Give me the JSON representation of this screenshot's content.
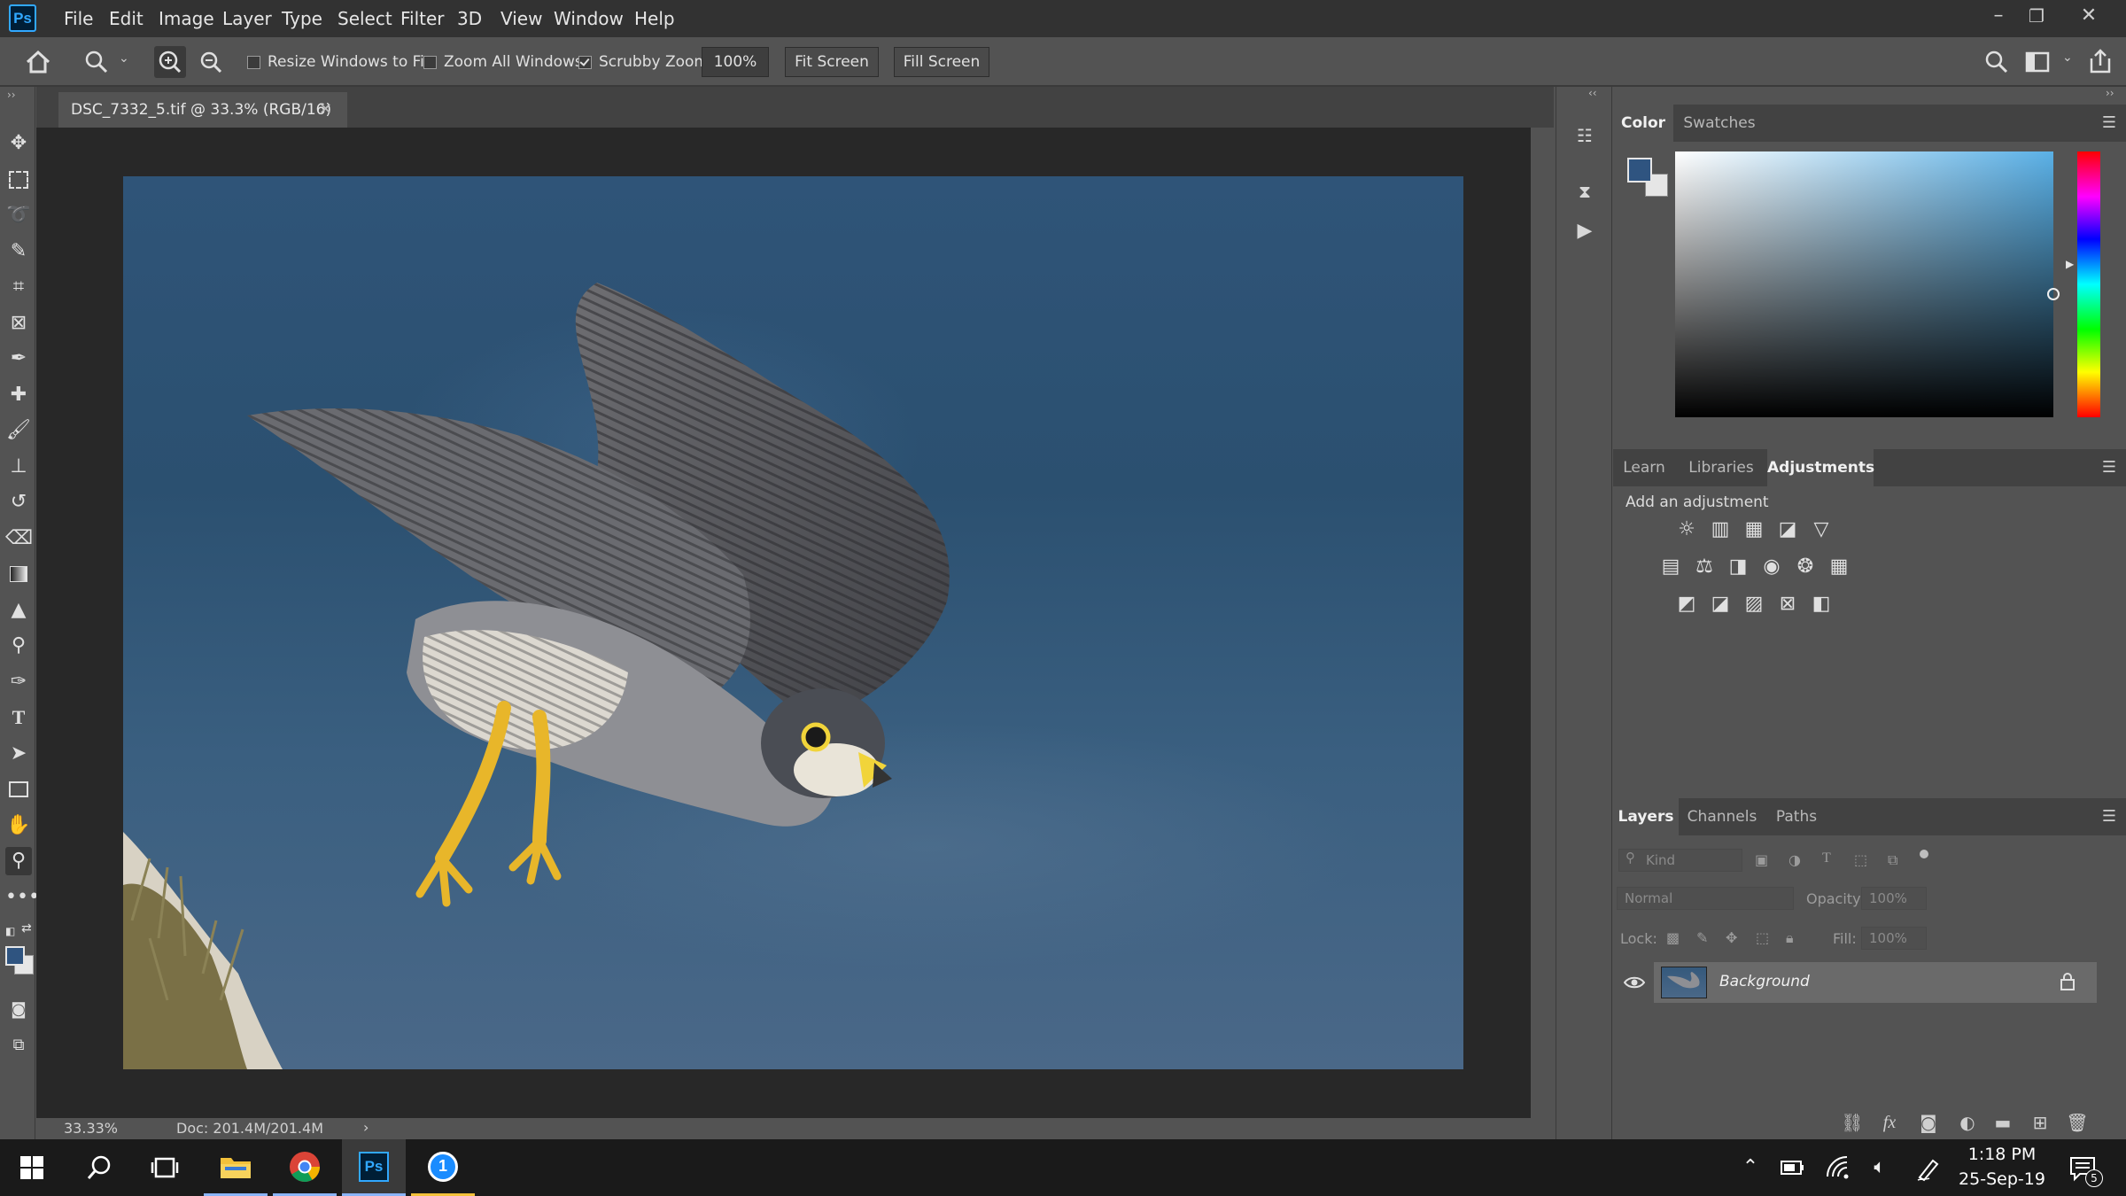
{
  "app": {
    "logo": "Ps"
  },
  "menu": [
    "File",
    "Edit",
    "Image",
    "Layer",
    "Type",
    "Select",
    "Filter",
    "3D",
    "View",
    "Window",
    "Help"
  ],
  "window_controls": {
    "minimize": "–",
    "restore": "❐",
    "close": "✕"
  },
  "options": {
    "resize_windows_label": "Resize Windows to Fit",
    "resize_windows_checked": false,
    "zoom_all_label": "Zoom All Windows",
    "zoom_all_checked": false,
    "scrubby_label": "Scrubby Zoom",
    "scrubby_checked": true,
    "zoom_value": "100%",
    "fit_screen": "Fit Screen",
    "fill_screen": "Fill Screen"
  },
  "tools": [
    "move-tool",
    "marquee-tool",
    "lasso-tool",
    "quick-select-tool",
    "crop-tool",
    "frame-tool",
    "eyedropper-tool",
    "healing-tool",
    "brush-tool",
    "stamp-tool",
    "history-brush-tool",
    "eraser-tool",
    "gradient-tool",
    "blur-tool",
    "dodge-tool",
    "pen-tool",
    "type-tool",
    "path-select-tool",
    "rectangle-tool",
    "hand-tool",
    "zoom-tool",
    "more-tools"
  ],
  "colors": {
    "foreground": "#2f5480",
    "background": "#e6e6e6",
    "accent": "#31a8ff",
    "ui": "#535353"
  },
  "document": {
    "tab_title": "DSC_7332_5.tif @ 33.3% (RGB/16)",
    "close": "✕"
  },
  "status": {
    "zoom": "33.33%",
    "doc": "Doc: 201.4M/201.4M",
    "arrow": "›"
  },
  "color_panel": {
    "tabs": [
      "Color",
      "Swatches"
    ],
    "active": 0
  },
  "adjustments_panel": {
    "tabs": [
      "Learn",
      "Libraries",
      "Adjustments"
    ],
    "active": 2,
    "hint": "Add an adjustment"
  },
  "layers_panel": {
    "tabs": [
      "Layers",
      "Channels",
      "Paths"
    ],
    "active": 0,
    "filter_placeholder": "Kind",
    "blend_mode": "Normal",
    "opacity_label": "Opacity:",
    "opacity_value": "100%",
    "lock_label": "Lock:",
    "fill_label": "Fill:",
    "fill_value": "100%",
    "layers": [
      {
        "name": "Background",
        "visible": true,
        "locked": true
      }
    ]
  },
  "taskbar": {
    "time": "1:18 PM",
    "date": "25-Sep-19",
    "notifications": "5",
    "ps_label": "Ps",
    "onepassword_label": "1"
  }
}
